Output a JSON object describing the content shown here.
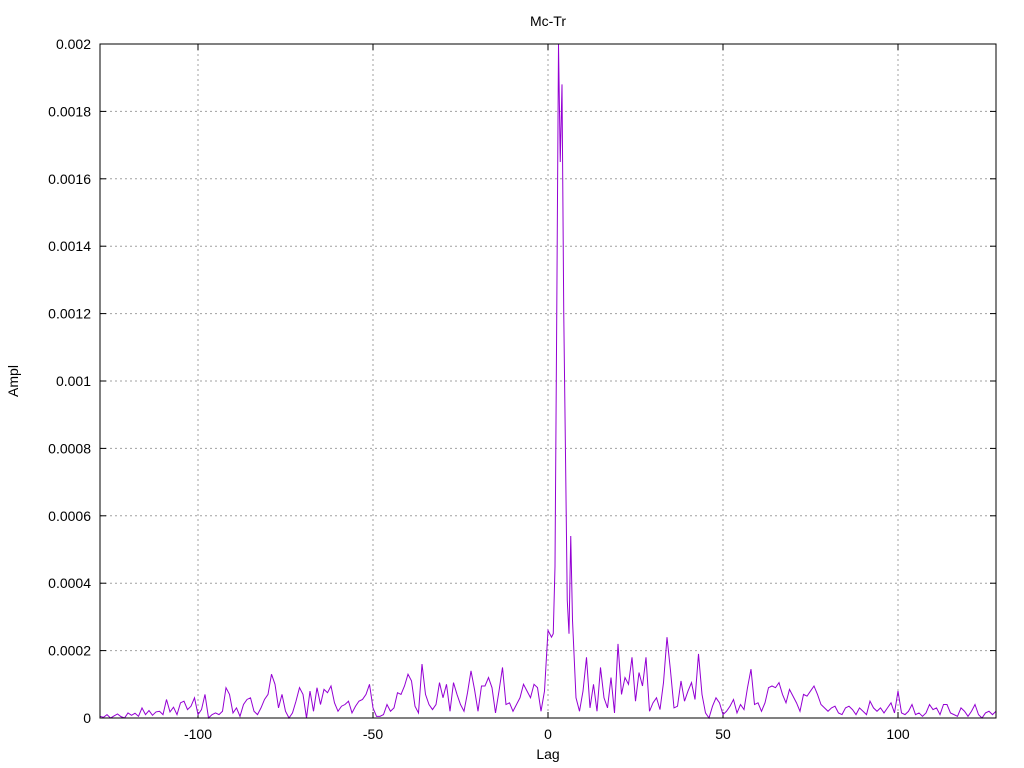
{
  "chart_data": {
    "type": "line",
    "title": "Mc-Tr",
    "xlabel": "Lag",
    "ylabel": "Ampl",
    "xlim": [
      -128,
      128
    ],
    "ylim": [
      0,
      0.002
    ],
    "grid": true,
    "line_color": "#9400d3",
    "x_ticks": [
      {
        "value": -100,
        "label": "-100"
      },
      {
        "value": -50,
        "label": "-50"
      },
      {
        "value": 0,
        "label": "0"
      },
      {
        "value": 50,
        "label": "50"
      },
      {
        "value": 100,
        "label": "100"
      }
    ],
    "y_ticks": [
      {
        "value": 0,
        "label": "0"
      },
      {
        "value": 0.0002,
        "label": "0.0002"
      },
      {
        "value": 0.0004,
        "label": "0.0004"
      },
      {
        "value": 0.0006,
        "label": "0.0006"
      },
      {
        "value": 0.0008,
        "label": "0.0008"
      },
      {
        "value": 0.001,
        "label": "0.001"
      },
      {
        "value": 0.0012,
        "label": "0.0012"
      },
      {
        "value": 0.0014,
        "label": "0.0014"
      },
      {
        "value": 0.0016,
        "label": "0.0016"
      },
      {
        "value": 0.0018,
        "label": "0.0018"
      },
      {
        "value": 0.002,
        "label": "0.002"
      }
    ],
    "series": [
      {
        "points": [
          [
            -128,
            5e-06
          ],
          [
            -127,
            2e-06
          ],
          [
            -126,
            1e-05
          ],
          [
            -125,
            0
          ],
          [
            -124,
            6e-06
          ],
          [
            -123,
            1.2e-05
          ],
          [
            -122,
            4e-06
          ],
          [
            -121,
            0
          ],
          [
            -120,
            1.5e-05
          ],
          [
            -119,
            8e-06
          ],
          [
            -118,
            1.4e-05
          ],
          [
            -117,
            5e-06
          ],
          [
            -116,
            3e-05
          ],
          [
            -115,
            1e-05
          ],
          [
            -114,
            2.2e-05
          ],
          [
            -113,
            8e-06
          ],
          [
            -112,
            1.8e-05
          ],
          [
            -111,
            2e-05
          ],
          [
            -110,
            1e-05
          ],
          [
            -109,
            5.5e-05
          ],
          [
            -108,
            1.8e-05
          ],
          [
            -107,
            3.2e-05
          ],
          [
            -106,
            1e-05
          ],
          [
            -105,
            4.5e-05
          ],
          [
            -104,
            5e-05
          ],
          [
            -103,
            2.5e-05
          ],
          [
            -102,
            3.5e-05
          ],
          [
            -101,
            6e-05
          ],
          [
            -100,
            1e-05
          ],
          [
            -99,
            2.5e-05
          ],
          [
            -98,
            7e-05
          ],
          [
            -97,
            0
          ],
          [
            -96,
            1e-05
          ],
          [
            -95,
            1.5e-05
          ],
          [
            -94,
            1e-05
          ],
          [
            -93,
            2e-05
          ],
          [
            -92,
            9e-05
          ],
          [
            -91,
            7e-05
          ],
          [
            -90,
            1.5e-05
          ],
          [
            -89,
            3e-05
          ],
          [
            -88,
            5e-06
          ],
          [
            -87,
            4e-05
          ],
          [
            -86,
            5.5e-05
          ],
          [
            -85,
            6e-05
          ],
          [
            -84,
            2e-05
          ],
          [
            -83,
            1e-05
          ],
          [
            -82,
            3e-05
          ],
          [
            -81,
            5.5e-05
          ],
          [
            -80,
            7e-05
          ],
          [
            -79,
            0.00013
          ],
          [
            -78,
            0.0001
          ],
          [
            -77,
            3e-05
          ],
          [
            -76,
            7e-05
          ],
          [
            -75,
            2e-05
          ],
          [
            -74,
            0
          ],
          [
            -73,
            1.5e-05
          ],
          [
            -72,
            5e-05
          ],
          [
            -71,
            9e-05
          ],
          [
            -70,
            7e-05
          ],
          [
            -69,
            0
          ],
          [
            -68,
            8e-05
          ],
          [
            -67,
            2e-05
          ],
          [
            -66,
            9e-05
          ],
          [
            -65,
            4e-05
          ],
          [
            -64,
            8.5e-05
          ],
          [
            -63,
            7.5e-05
          ],
          [
            -62,
            9.5e-05
          ],
          [
            -61,
            4.5e-05
          ],
          [
            -60,
            2e-05
          ],
          [
            -59,
            3.5e-05
          ],
          [
            -58,
            4e-05
          ],
          [
            -57,
            5e-05
          ],
          [
            -56,
            1.5e-05
          ],
          [
            -55,
            3.5e-05
          ],
          [
            -54,
            5e-05
          ],
          [
            -53,
            5.5e-05
          ],
          [
            -52,
            7e-05
          ],
          [
            -51,
            0.0001
          ],
          [
            -50,
            3e-05
          ],
          [
            -49,
            5e-06
          ],
          [
            -48,
            5e-06
          ],
          [
            -47,
            1e-05
          ],
          [
            -46,
            4e-05
          ],
          [
            -45,
            2e-05
          ],
          [
            -44,
            3e-05
          ],
          [
            -43,
            7.5e-05
          ],
          [
            -42,
            7e-05
          ],
          [
            -41,
            9.5e-05
          ],
          [
            -40,
            0.00013
          ],
          [
            -39,
            0.00011
          ],
          [
            -38,
            3.5e-05
          ],
          [
            -37,
            1.5e-05
          ],
          [
            -36,
            0.00016
          ],
          [
            -35,
            7e-05
          ],
          [
            -34,
            4e-05
          ],
          [
            -33,
            2.5e-05
          ],
          [
            -32,
            4e-05
          ],
          [
            -31,
            0.000105
          ],
          [
            -30,
            6e-05
          ],
          [
            -29,
            0.0001
          ],
          [
            -28,
            2e-05
          ],
          [
            -27,
            0.000105
          ],
          [
            -26,
            7e-05
          ],
          [
            -25,
            4e-05
          ],
          [
            -24,
            2e-05
          ],
          [
            -23,
            7.5e-05
          ],
          [
            -22,
            0.00014
          ],
          [
            -21,
            8.5e-05
          ],
          [
            -20,
            2e-05
          ],
          [
            -19,
            9.5e-05
          ],
          [
            -18,
            9.5e-05
          ],
          [
            -17,
            0.00012
          ],
          [
            -16,
            9e-05
          ],
          [
            -15,
            1.5e-05
          ],
          [
            -14,
            8e-05
          ],
          [
            -13,
            0.00015
          ],
          [
            -12,
            4e-05
          ],
          [
            -11,
            4.5e-05
          ],
          [
            -10,
            2e-05
          ],
          [
            -9,
            4e-05
          ],
          [
            -8,
            6e-05
          ],
          [
            -7,
            0.0001
          ],
          [
            -6,
            8e-05
          ],
          [
            -5,
            6e-05
          ],
          [
            -4,
            0.0001
          ],
          [
            -3,
            9e-05
          ],
          [
            -2,
            2e-05
          ],
          [
            -1,
            8e-05
          ],
          [
            0,
            0.00026
          ],
          [
            1,
            0.00024
          ],
          [
            1.5,
            0.00025
          ],
          [
            2,
            0.00045
          ],
          [
            2.5,
            0.0012
          ],
          [
            3,
            0.002
          ],
          [
            3.5,
            0.00165
          ],
          [
            4,
            0.00188
          ],
          [
            4.5,
            0.0012
          ],
          [
            5,
            0.00078
          ],
          [
            5.5,
            0.00035
          ],
          [
            6,
            0.00025
          ],
          [
            6.5,
            0.00054
          ],
          [
            7,
            0.00029
          ],
          [
            8,
            6e-05
          ],
          [
            9,
            2e-05
          ],
          [
            10,
            8e-05
          ],
          [
            11,
            0.00018
          ],
          [
            12,
            3e-05
          ],
          [
            13,
            0.0001
          ],
          [
            14,
            2e-05
          ],
          [
            15,
            0.00015
          ],
          [
            16,
            6e-05
          ],
          [
            17,
            3e-05
          ],
          [
            18,
            0.00012
          ],
          [
            19,
            1.5e-05
          ],
          [
            20,
            0.00022
          ],
          [
            21,
            7e-05
          ],
          [
            22,
            0.00012
          ],
          [
            23,
            0.0001
          ],
          [
            24,
            0.00018
          ],
          [
            25,
            5e-05
          ],
          [
            26,
            0.000135
          ],
          [
            27,
            9.5e-05
          ],
          [
            28,
            0.00018
          ],
          [
            29,
            2e-05
          ],
          [
            30,
            4.5e-05
          ],
          [
            31,
            6e-05
          ],
          [
            32,
            2.5e-05
          ],
          [
            33,
            0.000105
          ],
          [
            34,
            0.00024
          ],
          [
            35,
            0.00014
          ],
          [
            36,
            3e-05
          ],
          [
            37,
            3.5e-05
          ],
          [
            38,
            0.00011
          ],
          [
            39,
            5e-05
          ],
          [
            40,
            8e-05
          ],
          [
            41,
            0.000105
          ],
          [
            42,
            5.5e-05
          ],
          [
            43,
            0.00019
          ],
          [
            44,
            7e-05
          ],
          [
            45,
            1.5e-05
          ],
          [
            46,
            0
          ],
          [
            47,
            3.5e-05
          ],
          [
            48,
            6e-05
          ],
          [
            49,
            4.5e-05
          ],
          [
            50,
            1e-05
          ],
          [
            51,
            2e-05
          ],
          [
            52,
            3.5e-05
          ],
          [
            53,
            5.5e-05
          ],
          [
            54,
            1.5e-05
          ],
          [
            55,
            4e-05
          ],
          [
            56,
            2.5e-05
          ],
          [
            57,
            9e-05
          ],
          [
            58,
            0.000145
          ],
          [
            59,
            4e-05
          ],
          [
            60,
            4.5e-05
          ],
          [
            61,
            2e-05
          ],
          [
            62,
            4.5e-05
          ],
          [
            63,
            9e-05
          ],
          [
            64,
            9.5e-05
          ],
          [
            65,
            9e-05
          ],
          [
            66,
            0.000105
          ],
          [
            67,
            7e-05
          ],
          [
            68,
            4.5e-05
          ],
          [
            69,
            8.5e-05
          ],
          [
            70,
            6.5e-05
          ],
          [
            71,
            4.5e-05
          ],
          [
            72,
            2e-05
          ],
          [
            73,
            7e-05
          ],
          [
            74,
            6.5e-05
          ],
          [
            75,
            8e-05
          ],
          [
            76,
            9.5e-05
          ],
          [
            77,
            7e-05
          ],
          [
            78,
            4e-05
          ],
          [
            79,
            3e-05
          ],
          [
            80,
            2e-05
          ],
          [
            81,
            3e-05
          ],
          [
            82,
            3.5e-05
          ],
          [
            83,
            1.5e-05
          ],
          [
            84,
            1e-05
          ],
          [
            85,
            3e-05
          ],
          [
            86,
            3.5e-05
          ],
          [
            87,
            2.5e-05
          ],
          [
            88,
            1e-05
          ],
          [
            89,
            3e-05
          ],
          [
            90,
            2e-05
          ],
          [
            91,
            1e-05
          ],
          [
            92,
            5e-05
          ],
          [
            93,
            3e-05
          ],
          [
            94,
            2e-05
          ],
          [
            95,
            3e-05
          ],
          [
            96,
            1.5e-05
          ],
          [
            97,
            3e-05
          ],
          [
            98,
            4.5e-05
          ],
          [
            99,
            1.5e-05
          ],
          [
            100,
            8e-05
          ],
          [
            101,
            1.5e-05
          ],
          [
            102,
            1e-05
          ],
          [
            103,
            2e-05
          ],
          [
            104,
            4e-05
          ],
          [
            105,
            1e-05
          ],
          [
            106,
            1.5e-05
          ],
          [
            107,
            5e-06
          ],
          [
            108,
            1.5e-05
          ],
          [
            109,
            4e-05
          ],
          [
            110,
            2.5e-05
          ],
          [
            111,
            3e-05
          ],
          [
            112,
            1e-05
          ],
          [
            113,
            4e-05
          ],
          [
            114,
            4e-05
          ],
          [
            115,
            1.5e-05
          ],
          [
            116,
            1e-05
          ],
          [
            117,
            5e-06
          ],
          [
            118,
            3e-05
          ],
          [
            119,
            2e-05
          ],
          [
            120,
            5e-06
          ],
          [
            121,
            2e-05
          ],
          [
            122,
            4e-05
          ],
          [
            123,
            1e-05
          ],
          [
            124,
            0
          ],
          [
            125,
            1.5e-05
          ],
          [
            126,
            2e-05
          ],
          [
            127,
            1e-05
          ],
          [
            128,
            2e-05
          ]
        ]
      }
    ]
  }
}
